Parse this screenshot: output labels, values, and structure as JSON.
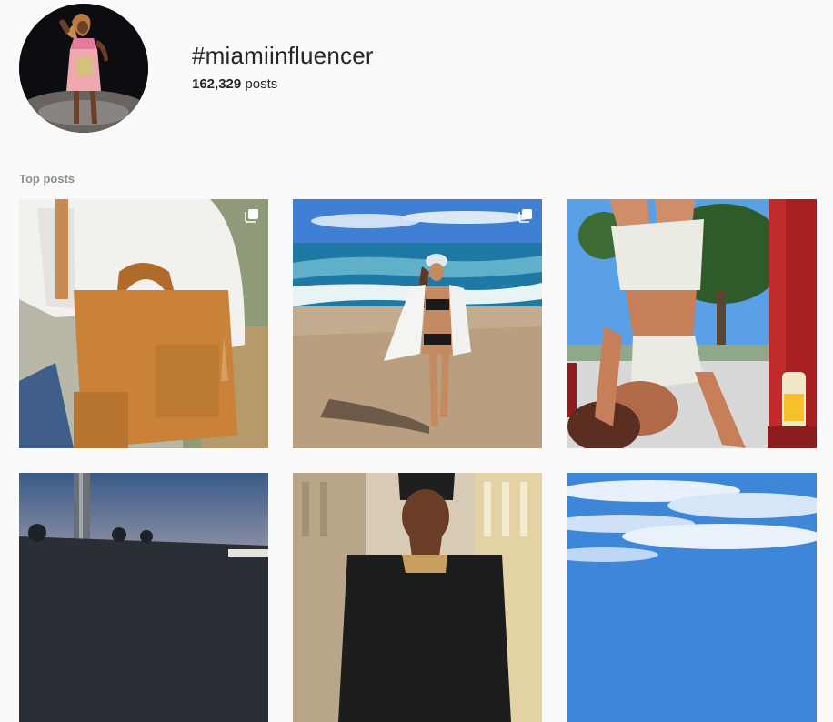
{
  "hashtag": {
    "title": "#miamiinfluencer",
    "posts_count": "162,329",
    "posts_word": "posts"
  },
  "sections": {
    "top_posts_label": "Top posts"
  },
  "posts": [
    {
      "id": "bag-post",
      "subject": "woman with tan leather backpack",
      "multi": true
    },
    {
      "id": "beach-post",
      "subject": "woman in bikini on beach",
      "multi": true
    },
    {
      "id": "handstand-post",
      "subject": "man doing handstand",
      "multi": false
    },
    {
      "id": "sunset-post",
      "subject": "palm trees at dusk",
      "multi": false
    },
    {
      "id": "portrait-post",
      "subject": "man in beanie",
      "multi": false
    },
    {
      "id": "sky-post",
      "subject": "blue sky with clouds",
      "multi": false
    }
  ],
  "icons": {
    "multi_post": "carousel-icon"
  },
  "colors": {
    "background": "#fafafa",
    "text": "#262626",
    "muted": "#8e8e8e"
  }
}
